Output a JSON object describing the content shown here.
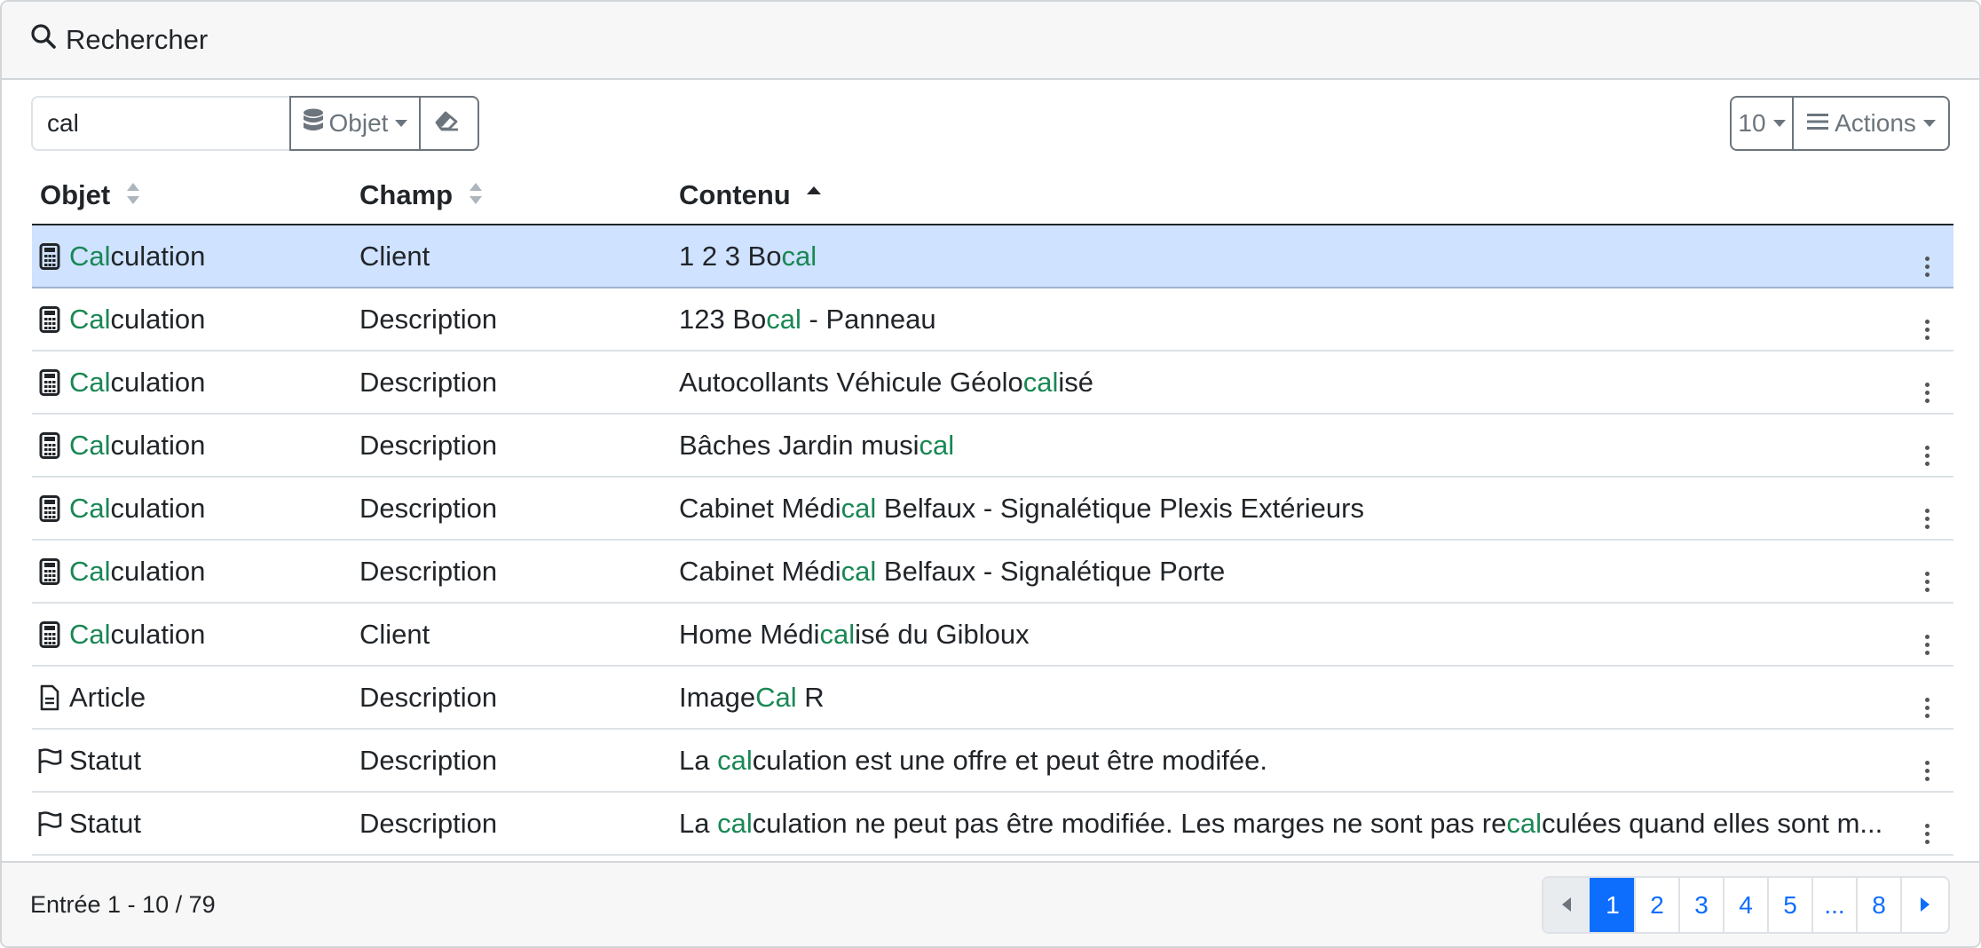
{
  "header": {
    "title": "Rechercher",
    "icon": "search-icon"
  },
  "search": {
    "value": "cal",
    "object_button": "Objet",
    "page_size": "10",
    "actions_label": "Actions"
  },
  "colors": {
    "highlight": "#198754",
    "selected_row": "#cfe2ff",
    "primary": "#0d6efd"
  },
  "table": {
    "columns": [
      {
        "label": "Objet",
        "sort": "none"
      },
      {
        "label": "Champ",
        "sort": "none"
      },
      {
        "label": "Contenu",
        "sort": "ascending"
      }
    ],
    "rows": [
      {
        "icon": "calculator-icon",
        "object_prefix": "Cal",
        "object_rest": "culation",
        "field": "Client",
        "content": [
          {
            "t": "1 2 3 Bo"
          },
          {
            "t": "cal",
            "h": true
          }
        ],
        "selected": true
      },
      {
        "icon": "calculator-icon",
        "object_prefix": "Cal",
        "object_rest": "culation",
        "field": "Description",
        "content": [
          {
            "t": "123 Bo"
          },
          {
            "t": "cal",
            "h": true
          },
          {
            "t": " - Panneau"
          }
        ]
      },
      {
        "icon": "calculator-icon",
        "object_prefix": "Cal",
        "object_rest": "culation",
        "field": "Description",
        "content": [
          {
            "t": "Autocollants Véhicule Géolo"
          },
          {
            "t": "cal",
            "h": true
          },
          {
            "t": "isé"
          }
        ]
      },
      {
        "icon": "calculator-icon",
        "object_prefix": "Cal",
        "object_rest": "culation",
        "field": "Description",
        "content": [
          {
            "t": "Bâches Jardin musi"
          },
          {
            "t": "cal",
            "h": true
          }
        ]
      },
      {
        "icon": "calculator-icon",
        "object_prefix": "Cal",
        "object_rest": "culation",
        "field": "Description",
        "content": [
          {
            "t": "Cabinet Médi"
          },
          {
            "t": "cal",
            "h": true
          },
          {
            "t": " Belfaux - Signalétique Plexis Extérieurs"
          }
        ]
      },
      {
        "icon": "calculator-icon",
        "object_prefix": "Cal",
        "object_rest": "culation",
        "field": "Description",
        "content": [
          {
            "t": "Cabinet Médi"
          },
          {
            "t": "cal",
            "h": true
          },
          {
            "t": " Belfaux - Signalétique Porte"
          }
        ]
      },
      {
        "icon": "calculator-icon",
        "object_prefix": "Cal",
        "object_rest": "culation",
        "field": "Client",
        "content": [
          {
            "t": "Home Médi"
          },
          {
            "t": "cal",
            "h": true
          },
          {
            "t": "isé du Gibloux"
          }
        ]
      },
      {
        "icon": "document-icon",
        "object_prefix": "",
        "object_rest": "Article",
        "field": "Description",
        "content": [
          {
            "t": "Image"
          },
          {
            "t": "Cal",
            "h": true
          },
          {
            "t": " R"
          }
        ]
      },
      {
        "icon": "flag-icon",
        "object_prefix": "",
        "object_rest": "Statut",
        "field": "Description",
        "content": [
          {
            "t": "La "
          },
          {
            "t": "cal",
            "h": true
          },
          {
            "t": "culation est une offre et peut être modifée."
          }
        ]
      },
      {
        "icon": "flag-icon",
        "object_prefix": "",
        "object_rest": "Statut",
        "field": "Description",
        "content": [
          {
            "t": "La "
          },
          {
            "t": "cal",
            "h": true
          },
          {
            "t": "culation ne peut pas être modifiée. Les marges ne sont pas re"
          },
          {
            "t": "cal",
            "h": true
          },
          {
            "t": "culées quand elles sont m..."
          }
        ]
      }
    ]
  },
  "footer": {
    "entries_text": "Entrée 1 - 10 / 79",
    "pages": [
      "1",
      "2",
      "3",
      "4",
      "5",
      "...",
      "8"
    ],
    "current_page": "1"
  }
}
